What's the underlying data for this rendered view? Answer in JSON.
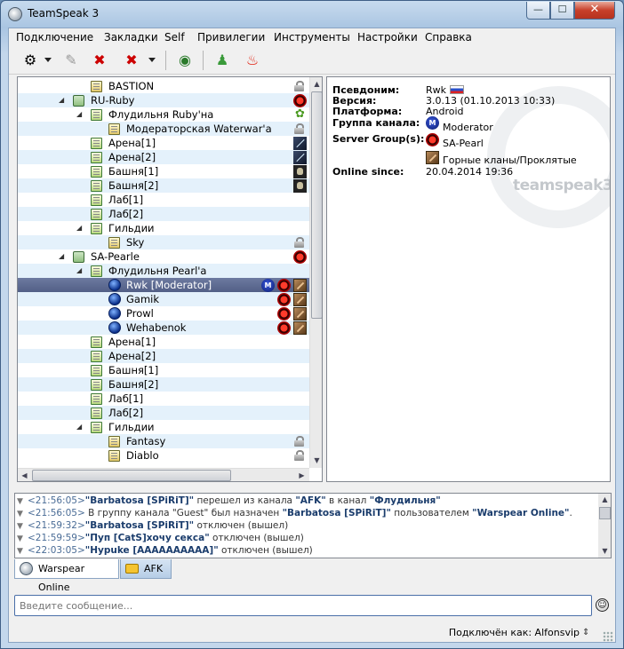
{
  "window": {
    "title": "TeamSpeak 3",
    "min": "—",
    "max": "☐",
    "close": "✕"
  },
  "menu": [
    "Подключение",
    "Закладки",
    "Self",
    "Привилегии",
    "Инструменты",
    "Настройки",
    "Справка"
  ],
  "tree": [
    {
      "label": "BASTION",
      "indent": 1,
      "kind": "channel",
      "lock": true
    },
    {
      "label": "RU-Ruby",
      "indent": 0,
      "kind": "server",
      "expanded": true,
      "badges": [
        "red"
      ]
    },
    {
      "label": "Флудильня Ruby'на",
      "indent": 1,
      "kind": "channel-green",
      "expanded": true,
      "badges": [
        "leaf"
      ]
    },
    {
      "label": "Модераторская Waterwar'a",
      "indent": 2,
      "kind": "channel",
      "lock": true
    },
    {
      "label": "Арена[1]",
      "indent": 1,
      "kind": "channel-green",
      "badges": [
        "sword"
      ]
    },
    {
      "label": "Арена[2]",
      "indent": 1,
      "kind": "channel-green",
      "badges": [
        "sword"
      ]
    },
    {
      "label": "Башня[1]",
      "indent": 1,
      "kind": "channel-green",
      "badges": [
        "skull"
      ]
    },
    {
      "label": "Башня[2]",
      "indent": 1,
      "kind": "channel-green",
      "badges": [
        "skull"
      ]
    },
    {
      "label": "Лаб[1]",
      "indent": 1,
      "kind": "channel-green"
    },
    {
      "label": "Лаб[2]",
      "indent": 1,
      "kind": "channel-green"
    },
    {
      "label": "Гильдии",
      "indent": 1,
      "kind": "channel-green",
      "expanded": true
    },
    {
      "label": "Sky",
      "indent": 2,
      "kind": "channel",
      "lock": true
    },
    {
      "label": "SA-Pearle",
      "indent": 0,
      "kind": "server",
      "expanded": true,
      "badges": [
        "red"
      ]
    },
    {
      "label": "Флудильня Pearl'a",
      "indent": 1,
      "kind": "channel-green",
      "expanded": true
    },
    {
      "label": "Rwk [Moderator]",
      "indent": 2,
      "kind": "user",
      "selected": true,
      "badges": [
        "mod",
        "red",
        "clan"
      ]
    },
    {
      "label": "Gamik",
      "indent": 2,
      "kind": "user",
      "badges": [
        "red",
        "clan"
      ]
    },
    {
      "label": "Prowl",
      "indent": 2,
      "kind": "user",
      "badges": [
        "red",
        "clan"
      ]
    },
    {
      "label": "Wehabenok",
      "indent": 2,
      "kind": "user",
      "badges": [
        "red",
        "clan"
      ]
    },
    {
      "label": "Арена[1]",
      "indent": 1,
      "kind": "channel-green"
    },
    {
      "label": "Арена[2]",
      "indent": 1,
      "kind": "channel-green"
    },
    {
      "label": "Башня[1]",
      "indent": 1,
      "kind": "channel-green"
    },
    {
      "label": "Башня[2]",
      "indent": 1,
      "kind": "channel-green"
    },
    {
      "label": "Лаб[1]",
      "indent": 1,
      "kind": "channel-green"
    },
    {
      "label": "Лаб[2]",
      "indent": 1,
      "kind": "channel-green"
    },
    {
      "label": "Гильдии",
      "indent": 1,
      "kind": "channel-green",
      "expanded": true
    },
    {
      "label": "Fantasy",
      "indent": 2,
      "kind": "channel",
      "lock": true
    },
    {
      "label": "Diablo",
      "indent": 2,
      "kind": "channel",
      "lock": true
    }
  ],
  "info": {
    "nickname_label": "Псевдоним:",
    "nickname": "Rwk",
    "version_label": "Версия:",
    "version": "3.0.13 (01.10.2013 10:33)",
    "platform_label": "Платформа:",
    "platform": "Android",
    "channel_group_label": "Группа канала:",
    "channel_group": "Moderator",
    "server_groups_label": "Server Group(s):",
    "server_group_1": "SA-Pearl",
    "server_group_2": "Горные кланы/Проклятые",
    "online_since_label": "Online since:",
    "online_since": "20.04.2014 19:36",
    "watermark": "teamspeak3"
  },
  "chat": [
    {
      "time": "<21:56:05>",
      "parts": [
        [
          "b",
          "\"Barbatosa [SPiRiT]\""
        ],
        [
          "t",
          " перешел из канала "
        ],
        [
          "b",
          "\"AFK\""
        ],
        [
          "t",
          " в канал "
        ],
        [
          "b",
          "\"Флудильня\""
        ]
      ]
    },
    {
      "time": "<21:56:05>",
      "parts": [
        [
          "t",
          " В группу канала \"Guest\" был назначен "
        ],
        [
          "b",
          "\"Barbatosa [SPiRiT]\""
        ],
        [
          "t",
          " пользователем "
        ],
        [
          "b",
          "\"Warspear Online\""
        ],
        [
          "t",
          "."
        ]
      ]
    },
    {
      "time": "<21:59:32>",
      "parts": [
        [
          "b",
          "\"Barbatosa [SPiRiT]\""
        ],
        [
          "t",
          " отключен (вышел)"
        ]
      ]
    },
    {
      "time": "<21:59:59>",
      "parts": [
        [
          "b",
          "\"Пуп  [CatS]хочу секса\""
        ],
        [
          "t",
          " отключен (вышел)"
        ]
      ]
    },
    {
      "time": "<22:03:05>",
      "parts": [
        [
          "b",
          "\"Hypuke [AAAAAAAAAA]\""
        ],
        [
          "t",
          " отключен (вышел)"
        ]
      ]
    }
  ],
  "tabs": [
    {
      "label": "Warspear Online",
      "active": true
    },
    {
      "label": "AFK",
      "active": false
    }
  ],
  "input": {
    "placeholder": "Введите сообщение..."
  },
  "status": {
    "text": "Подключён как: Alfonsvip"
  }
}
